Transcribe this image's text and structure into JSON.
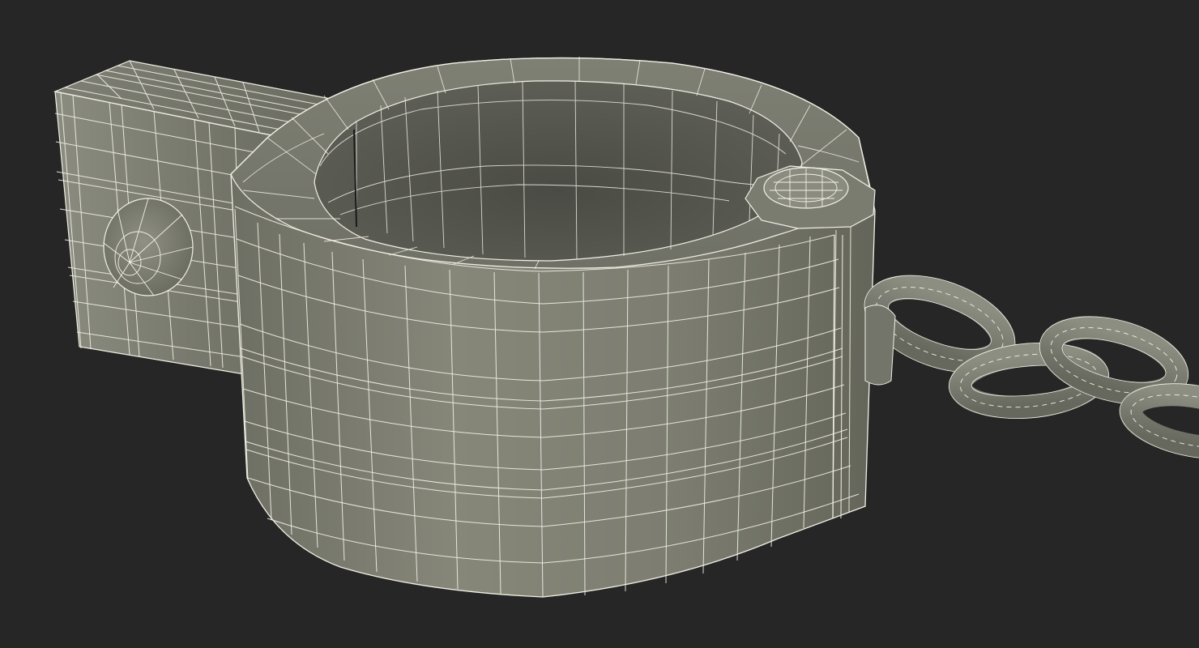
{
  "scene": {
    "subject": "",
    "render_style": "wireframe-on-shaded",
    "colors": {
      "background": "#262626",
      "surface_light": "#8c8c80",
      "surface_mid": "#7a7b6e",
      "surface_dark": "#5b5c52",
      "inner_dark": "#4c4d45",
      "wire": "#f2f0e6"
    }
  }
}
